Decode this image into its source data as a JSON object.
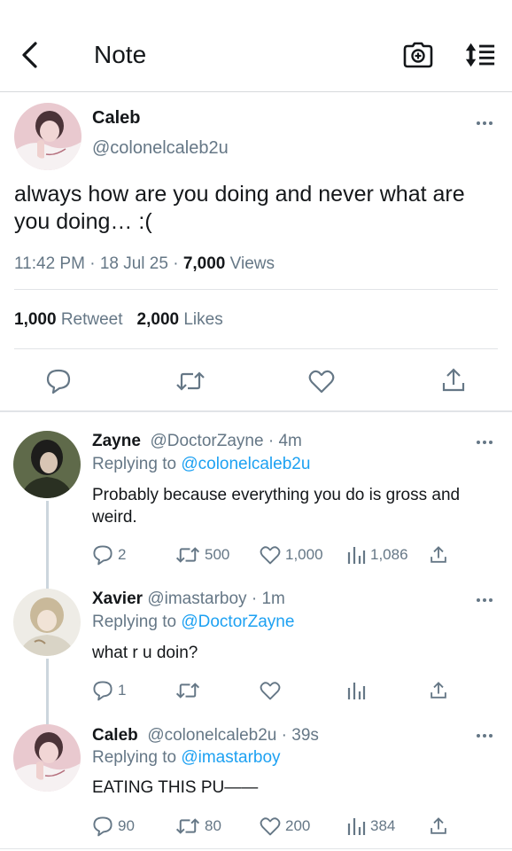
{
  "header": {
    "title": "Note",
    "icons": [
      "back-chevron-icon",
      "camera-icon",
      "sort-list-icon"
    ]
  },
  "main_tweet": {
    "name": "Caleb",
    "handle": "@colonelcaleb2u",
    "text": "always how are you doing and never what are you doing… :(",
    "time": "11:42 PM",
    "date": "18 Jul 25",
    "views_count": "7,000",
    "views_label": "Views",
    "retweet_count": "1,000",
    "retweet_label": "Retweet",
    "likes_count": "2,000",
    "likes_label": "Likes",
    "actions": [
      "reply-icon",
      "retweet-icon",
      "like-icon",
      "share-icon"
    ]
  },
  "replies": [
    {
      "name": "Zayne",
      "handle": "@DoctorZayne",
      "time": "4m",
      "replying_prefix": "Replying to",
      "replying_to": "@colonelcaleb2u",
      "text": "Probably because everything you do is gross and weird.",
      "replies": "2",
      "retweets": "500",
      "likes": "1,000",
      "views": "1,086"
    },
    {
      "name": "Xavier",
      "handle": "@imastarboy",
      "time": "1m",
      "replying_prefix": "Replying to",
      "replying_to": "@DoctorZayne",
      "text": "what r u doin?",
      "replies": "1",
      "retweets": "",
      "likes": "",
      "views": ""
    },
    {
      "name": "Caleb",
      "handle": "@colonelcaleb2u",
      "time": "39s",
      "replying_prefix": "Replying to",
      "replying_to": "@imastarboy",
      "text": "EATING THIS PU——",
      "replies": "90",
      "retweets": "80",
      "likes": "200",
      "views": "384"
    }
  ],
  "colors": {
    "link": "#1da1f2",
    "secondary_text": "#657786",
    "primary_text": "#14171a",
    "divider": "#e1e4e7"
  }
}
